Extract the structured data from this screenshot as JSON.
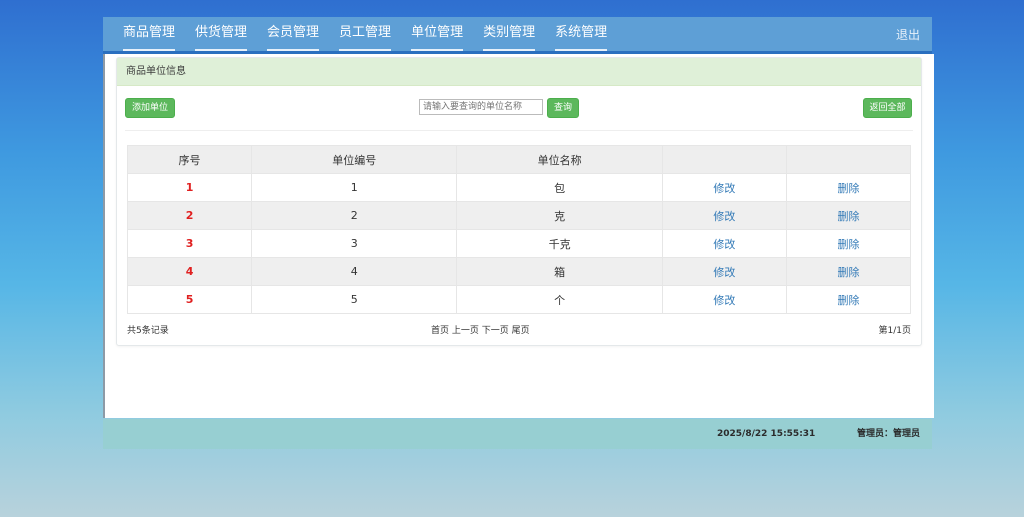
{
  "nav": {
    "items": [
      "商品管理",
      "供货管理",
      "会员管理",
      "员工管理",
      "单位管理",
      "类别管理",
      "系统管理"
    ],
    "logout": "退出"
  },
  "panel": {
    "title": "商品单位信息",
    "add_button": "添加单位",
    "search_placeholder": "请输入要查询的单位名称",
    "search_button": "查询",
    "return_all_button": "返回全部"
  },
  "table": {
    "headers": [
      "序号",
      "单位编号",
      "单位名称",
      "",
      ""
    ],
    "rows": [
      {
        "index": "1",
        "code": "1",
        "name": "包",
        "edit": "修改",
        "delete": "删除"
      },
      {
        "index": "2",
        "code": "2",
        "name": "克",
        "edit": "修改",
        "delete": "删除"
      },
      {
        "index": "3",
        "code": "3",
        "name": "千克",
        "edit": "修改",
        "delete": "删除"
      },
      {
        "index": "4",
        "code": "4",
        "name": "箱",
        "edit": "修改",
        "delete": "删除"
      },
      {
        "index": "5",
        "code": "5",
        "name": "个",
        "edit": "修改",
        "delete": "删除"
      }
    ]
  },
  "pagination": {
    "total": "共5条记录",
    "first": "首页",
    "prev": "上一页",
    "next": "下一页",
    "last": "尾页",
    "page_info": "第1/1页"
  },
  "status": {
    "datetime": "2025/8/22 15:55:31",
    "user": "管理员：管理员"
  },
  "colors": {
    "accent_green": "#5cb85c",
    "link_blue": "#337ab7",
    "index_red": "#e02020"
  }
}
